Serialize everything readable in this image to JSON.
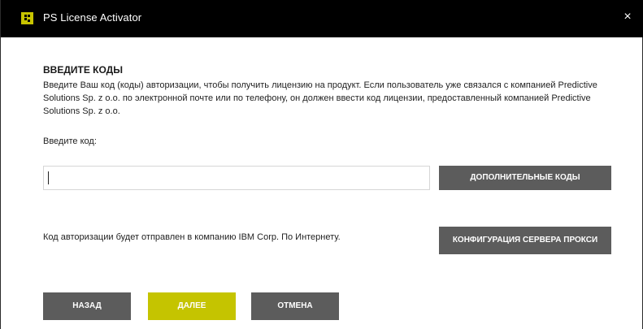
{
  "window": {
    "title": "PS License Activator",
    "close_glyph": "×",
    "icon": "app-icon"
  },
  "main": {
    "heading": "ВВЕДИТЕ КОДЫ",
    "description": "Введите Ваш код (коды) авторизации, чтобы получить лицензию на продукт. Если пользователь уже связался с компанией Predictive Solutions Sp. z o.o. по электронной почте или по телефону, он должен ввести код лицензии, предоставленный компанией Predictive Solutions Sp. z o.o.",
    "code_label": "Введите код:",
    "code_value": "",
    "extra_codes_label": "ДОПОЛНИТЕЛЬНЫЕ КОДЫ",
    "auth_note": "Код авторизации будет отправлен в компанию IBM Corp. По Интернету.",
    "proxy_label": "КОНФИГУРАЦИЯ СЕРВЕРА ПРОКСИ"
  },
  "footer": {
    "back_label": "НАЗАД",
    "next_label": "ДАЛЕЕ",
    "cancel_label": "ОТМЕНА"
  },
  "colors": {
    "accent": "#c5c400",
    "button": "#5c5c5c",
    "titlebar": "#000000"
  }
}
